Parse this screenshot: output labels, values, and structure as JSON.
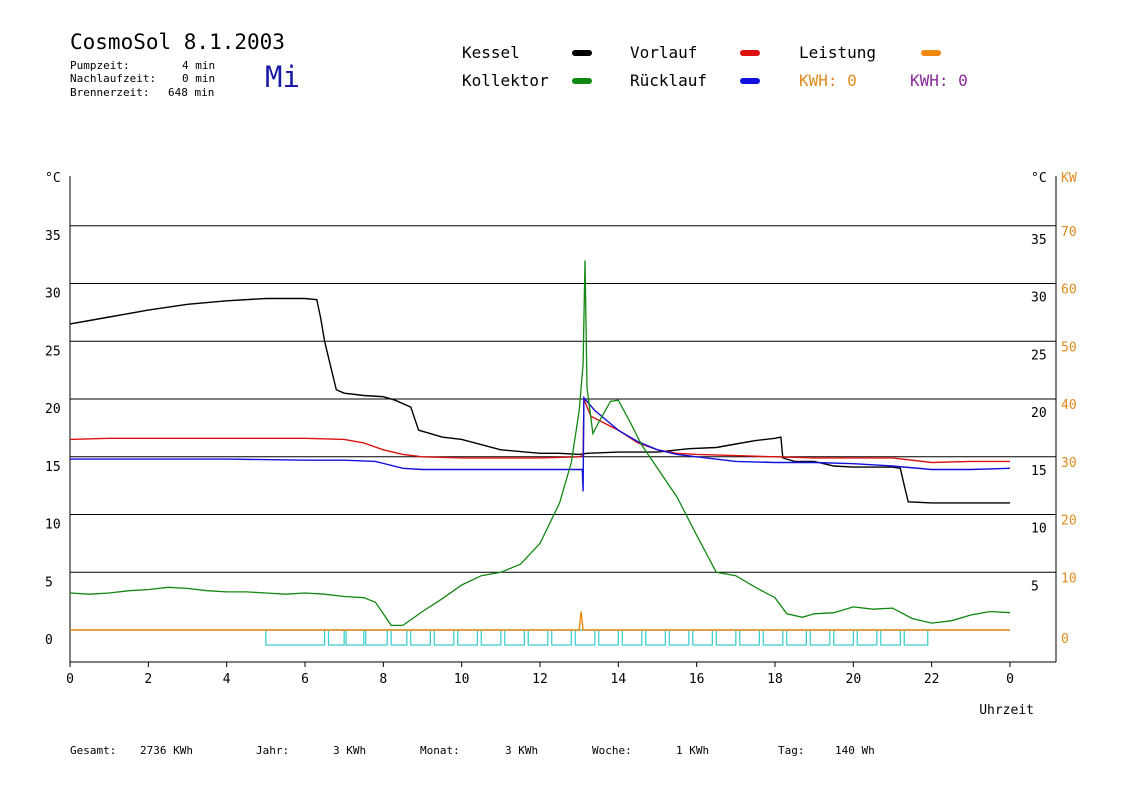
{
  "header": {
    "title": "CosmoSol 8.1.2003",
    "weekday": "Mi",
    "stats": [
      {
        "label": "Pumpzeit:",
        "value": "4 min"
      },
      {
        "label": "Nachlaufzeit:",
        "value": "0 min"
      },
      {
        "label": "Brennerzeit:",
        "value": "648 min"
      }
    ]
  },
  "legend": [
    {
      "name": "Kessel",
      "color": "#000000"
    },
    {
      "name": "Kollektor",
      "color": "#118811"
    },
    {
      "name": "Vorlauf",
      "color": "#dd1111"
    },
    {
      "name": "Rücklauf",
      "color": "#1111dd"
    },
    {
      "name": "Leistung",
      "color": "#ee8811"
    }
  ],
  "kwh": [
    {
      "text": "KWH: 0",
      "color": "#e08a1e"
    },
    {
      "text": "KWH: 0",
      "color": "#8a2a9a"
    }
  ],
  "footer": [
    {
      "label": "Gesamt:",
      "value": "2736 KWh"
    },
    {
      "label": "Jahr:",
      "value": "3 KWh"
    },
    {
      "label": "Monat:",
      "value": "3 KWh"
    },
    {
      "label": "Woche:",
      "value": "1 KWh"
    },
    {
      "label": "Tag:",
      "value": "140 Wh"
    }
  ],
  "chart_data": {
    "type": "line",
    "xlabel": "Uhrzeit",
    "x_ticks": [
      "0",
      "2",
      "4",
      "6",
      "8",
      "10",
      "12",
      "14",
      "16",
      "18",
      "20",
      "22",
      "0"
    ],
    "xlim": [
      0,
      24
    ],
    "y_left_unit": "°C",
    "y_right_unit": "°C",
    "y_right2_unit": "KW",
    "ylim": [
      0,
      40
    ],
    "y_right2_lim": [
      0,
      80
    ],
    "y_ticks_left": [
      "0",
      "5",
      "10",
      "15",
      "20",
      "25",
      "30",
      "35"
    ],
    "y_ticks_right": [
      "",
      "5",
      "10",
      "15",
      "20",
      "25",
      "30",
      "35"
    ],
    "y_ticks_right2": [
      "0",
      "10",
      "20",
      "30",
      "40",
      "50",
      "60",
      "70"
    ],
    "grid": true,
    "series": [
      {
        "name": "Kessel",
        "color": "#000000",
        "points": [
          [
            0,
            26.5
          ],
          [
            0.5,
            26.8
          ],
          [
            1,
            27.1
          ],
          [
            2,
            27.7
          ],
          [
            3,
            28.2
          ],
          [
            4,
            28.5
          ],
          [
            5,
            28.7
          ],
          [
            6,
            28.7
          ],
          [
            6.3,
            28.6
          ],
          [
            6.4,
            27
          ],
          [
            6.5,
            25
          ],
          [
            6.6,
            23.6
          ],
          [
            6.8,
            20.8
          ],
          [
            7,
            20.5
          ],
          [
            7.5,
            20.3
          ],
          [
            8,
            20.2
          ],
          [
            8.3,
            19.9
          ],
          [
            8.7,
            19.3
          ],
          [
            8.9,
            17.3
          ],
          [
            9.2,
            17
          ],
          [
            9.5,
            16.7
          ],
          [
            10,
            16.5
          ],
          [
            11,
            15.6
          ],
          [
            12,
            15.3
          ],
          [
            12.5,
            15.3
          ],
          [
            13,
            15.2
          ],
          [
            13.2,
            15.3
          ],
          [
            14,
            15.4
          ],
          [
            15,
            15.4
          ],
          [
            15.8,
            15.7
          ],
          [
            16.5,
            15.8
          ],
          [
            17,
            16.1
          ],
          [
            17.5,
            16.4
          ],
          [
            18,
            16.6
          ],
          [
            18.15,
            16.7
          ],
          [
            18.2,
            14.9
          ],
          [
            18.5,
            14.6
          ],
          [
            19,
            14.6
          ],
          [
            19.5,
            14.2
          ],
          [
            20,
            14.1
          ],
          [
            20.5,
            14.1
          ],
          [
            21,
            14.1
          ],
          [
            21.2,
            14.0
          ],
          [
            21.3,
            12.5
          ],
          [
            21.4,
            11.1
          ],
          [
            22,
            11.0
          ],
          [
            23,
            11.0
          ],
          [
            24,
            11.0
          ]
        ]
      },
      {
        "name": "Vorlauf",
        "color": "#dd1111",
        "points": [
          [
            0,
            16.5
          ],
          [
            1,
            16.6
          ],
          [
            2,
            16.6
          ],
          [
            3,
            16.6
          ],
          [
            4,
            16.6
          ],
          [
            5,
            16.6
          ],
          [
            6,
            16.6
          ],
          [
            7,
            16.5
          ],
          [
            7.5,
            16.2
          ],
          [
            8,
            15.6
          ],
          [
            8.5,
            15.2
          ],
          [
            9,
            15.0
          ],
          [
            10,
            14.9
          ],
          [
            11,
            14.9
          ],
          [
            12,
            14.9
          ],
          [
            13,
            15.0
          ],
          [
            13.1,
            15.1
          ],
          [
            13.12,
            20.0
          ],
          [
            13.3,
            18.5
          ],
          [
            14,
            17.3
          ],
          [
            14.5,
            16.2
          ],
          [
            15,
            15.6
          ],
          [
            15.5,
            15.3
          ],
          [
            16,
            15.2
          ],
          [
            17,
            15.1
          ],
          [
            18,
            15.0
          ],
          [
            19,
            14.9
          ],
          [
            20,
            14.9
          ],
          [
            21,
            14.9
          ],
          [
            22,
            14.5
          ],
          [
            23,
            14.6
          ],
          [
            24,
            14.6
          ]
        ]
      },
      {
        "name": "Rücklauf",
        "color": "#1111dd",
        "points": [
          [
            0,
            14.8
          ],
          [
            2,
            14.8
          ],
          [
            4,
            14.8
          ],
          [
            6,
            14.7
          ],
          [
            7,
            14.7
          ],
          [
            7.8,
            14.6
          ],
          [
            8.5,
            14.0
          ],
          [
            9,
            13.9
          ],
          [
            10,
            13.9
          ],
          [
            11,
            13.9
          ],
          [
            12,
            13.9
          ],
          [
            13,
            13.9
          ],
          [
            13.08,
            13.9
          ],
          [
            13.1,
            12.0
          ],
          [
            13.12,
            20.1
          ],
          [
            13.4,
            19.0
          ],
          [
            14,
            17.3
          ],
          [
            14.5,
            16.3
          ],
          [
            15,
            15.6
          ],
          [
            15.5,
            15.2
          ],
          [
            16,
            15.0
          ],
          [
            17,
            14.6
          ],
          [
            18,
            14.5
          ],
          [
            19,
            14.5
          ],
          [
            20,
            14.4
          ],
          [
            21,
            14.2
          ],
          [
            22,
            13.9
          ],
          [
            23,
            13.9
          ],
          [
            24,
            14.0
          ]
        ]
      },
      {
        "name": "Kollektor",
        "color": "#118811",
        "points": [
          [
            0,
            3.2
          ],
          [
            0.5,
            3.1
          ],
          [
            1,
            3.2
          ],
          [
            1.5,
            3.4
          ],
          [
            2,
            3.5
          ],
          [
            2.5,
            3.7
          ],
          [
            3,
            3.6
          ],
          [
            3.5,
            3.4
          ],
          [
            4,
            3.3
          ],
          [
            4.5,
            3.3
          ],
          [
            5,
            3.2
          ],
          [
            5.5,
            3.1
          ],
          [
            6,
            3.2
          ],
          [
            6.5,
            3.1
          ],
          [
            7,
            2.9
          ],
          [
            7.5,
            2.8
          ],
          [
            7.8,
            2.4
          ],
          [
            8.0,
            1.4
          ],
          [
            8.2,
            0.4
          ],
          [
            8.5,
            0.4
          ],
          [
            9,
            1.6
          ],
          [
            9.5,
            2.7
          ],
          [
            10,
            3.9
          ],
          [
            10.5,
            4.7
          ],
          [
            11,
            5.0
          ],
          [
            11.5,
            5.7
          ],
          [
            12,
            7.5
          ],
          [
            12.5,
            11.0
          ],
          [
            12.8,
            14.5
          ],
          [
            13.0,
            19.0
          ],
          [
            13.1,
            23.0
          ],
          [
            13.15,
            32.0
          ],
          [
            13.2,
            21.0
          ],
          [
            13.35,
            17.0
          ],
          [
            13.5,
            18.0
          ],
          [
            13.8,
            19.8
          ],
          [
            14,
            19.9
          ],
          [
            14.3,
            18.0
          ],
          [
            14.6,
            16.0
          ],
          [
            15,
            14.0
          ],
          [
            15.5,
            11.5
          ],
          [
            16,
            8.2
          ],
          [
            16.5,
            5.0
          ],
          [
            17,
            4.7
          ],
          [
            17.5,
            3.7
          ],
          [
            18,
            2.8
          ],
          [
            18.3,
            1.4
          ],
          [
            18.7,
            1.1
          ],
          [
            19,
            1.4
          ],
          [
            19.5,
            1.5
          ],
          [
            20,
            2.0
          ],
          [
            20.5,
            1.8
          ],
          [
            21,
            1.9
          ],
          [
            21.5,
            1.0
          ],
          [
            22,
            0.6
          ],
          [
            22.5,
            0.8
          ],
          [
            23,
            1.3
          ],
          [
            23.5,
            1.6
          ],
          [
            24,
            1.5
          ]
        ]
      },
      {
        "name": "Leistung",
        "color": "#ee8811",
        "points": [
          [
            0,
            0
          ],
          [
            13.0,
            0
          ],
          [
            13.05,
            1.6
          ],
          [
            13.1,
            0
          ],
          [
            24,
            0
          ]
        ]
      }
    ],
    "pump_markers": {
      "color": "#33cccc",
      "segments": [
        [
          5.0,
          6.5
        ],
        [
          6.6,
          7.0
        ],
        [
          7.05,
          7.5
        ],
        [
          7.55,
          8.1
        ],
        [
          8.2,
          8.6
        ],
        [
          8.7,
          9.2
        ],
        [
          9.3,
          9.8
        ],
        [
          9.9,
          10.4
        ],
        [
          10.5,
          11.0
        ],
        [
          11.1,
          11.6
        ],
        [
          11.7,
          12.2
        ],
        [
          12.3,
          12.8
        ],
        [
          12.9,
          13.4
        ],
        [
          13.5,
          14.0
        ],
        [
          14.1,
          14.6
        ],
        [
          14.7,
          15.2
        ],
        [
          15.3,
          15.8
        ],
        [
          15.9,
          16.4
        ],
        [
          16.5,
          17.0
        ],
        [
          17.1,
          17.6
        ],
        [
          17.7,
          18.2
        ],
        [
          18.3,
          18.8
        ],
        [
          18.9,
          19.4
        ],
        [
          19.5,
          20.0
        ],
        [
          20.1,
          20.6
        ],
        [
          20.7,
          21.2
        ],
        [
          21.3,
          21.9
        ]
      ]
    }
  }
}
